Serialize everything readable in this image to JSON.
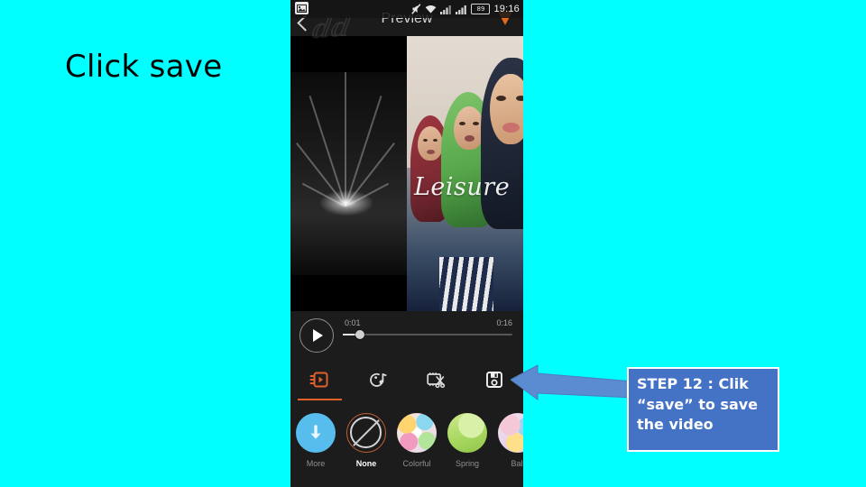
{
  "slide": {
    "background_color": "#00FFFF",
    "title": "Click save"
  },
  "phone": {
    "status_bar": {
      "screenshot_icon": "image-icon",
      "mute_icon": "mute-icon",
      "wifi_icon": "wifi-icon",
      "signal_icon_1": "signal-bars-icon",
      "signal_icon_2": "signal-bars-icon",
      "battery_level": "89",
      "time": "19:16"
    },
    "app_bar": {
      "title": "Preview",
      "back_icon": "back-chevron-icon",
      "flame_icon": "flame-icon"
    },
    "video": {
      "watermark": "Leisure"
    },
    "player": {
      "play_icon": "play-icon",
      "current_time": "0:01",
      "total_time": "0:16",
      "progress_percent": 10
    },
    "tabs": [
      {
        "icon": "effects-icon",
        "name": "effects",
        "active": true
      },
      {
        "icon": "music-icon",
        "name": "music",
        "active": false
      },
      {
        "icon": "trim-scissors-icon",
        "name": "trim",
        "active": false
      },
      {
        "icon": "save-floppy-icon",
        "name": "save",
        "active": false
      }
    ],
    "filters": [
      {
        "label": "More",
        "thumb": "download-circle",
        "selected": false
      },
      {
        "label": "None",
        "thumb": "none-slash",
        "selected": true
      },
      {
        "label": "Colorful",
        "thumb": "colorful-swatch",
        "selected": false
      },
      {
        "label": "Spring",
        "thumb": "spring-swatch",
        "selected": false
      },
      {
        "label": "Ball",
        "thumb": "ball-swatch",
        "selected": false
      }
    ],
    "accent_color": "#e0612a"
  },
  "callout": {
    "line1": "STEP 12 :  Clik",
    "line2": "“save” to save",
    "line3": "the video",
    "fill_color": "#4472C4",
    "border_color": "#FFFFFF",
    "arrow_color": "#5B8BD0",
    "arrow_direction": "left"
  }
}
